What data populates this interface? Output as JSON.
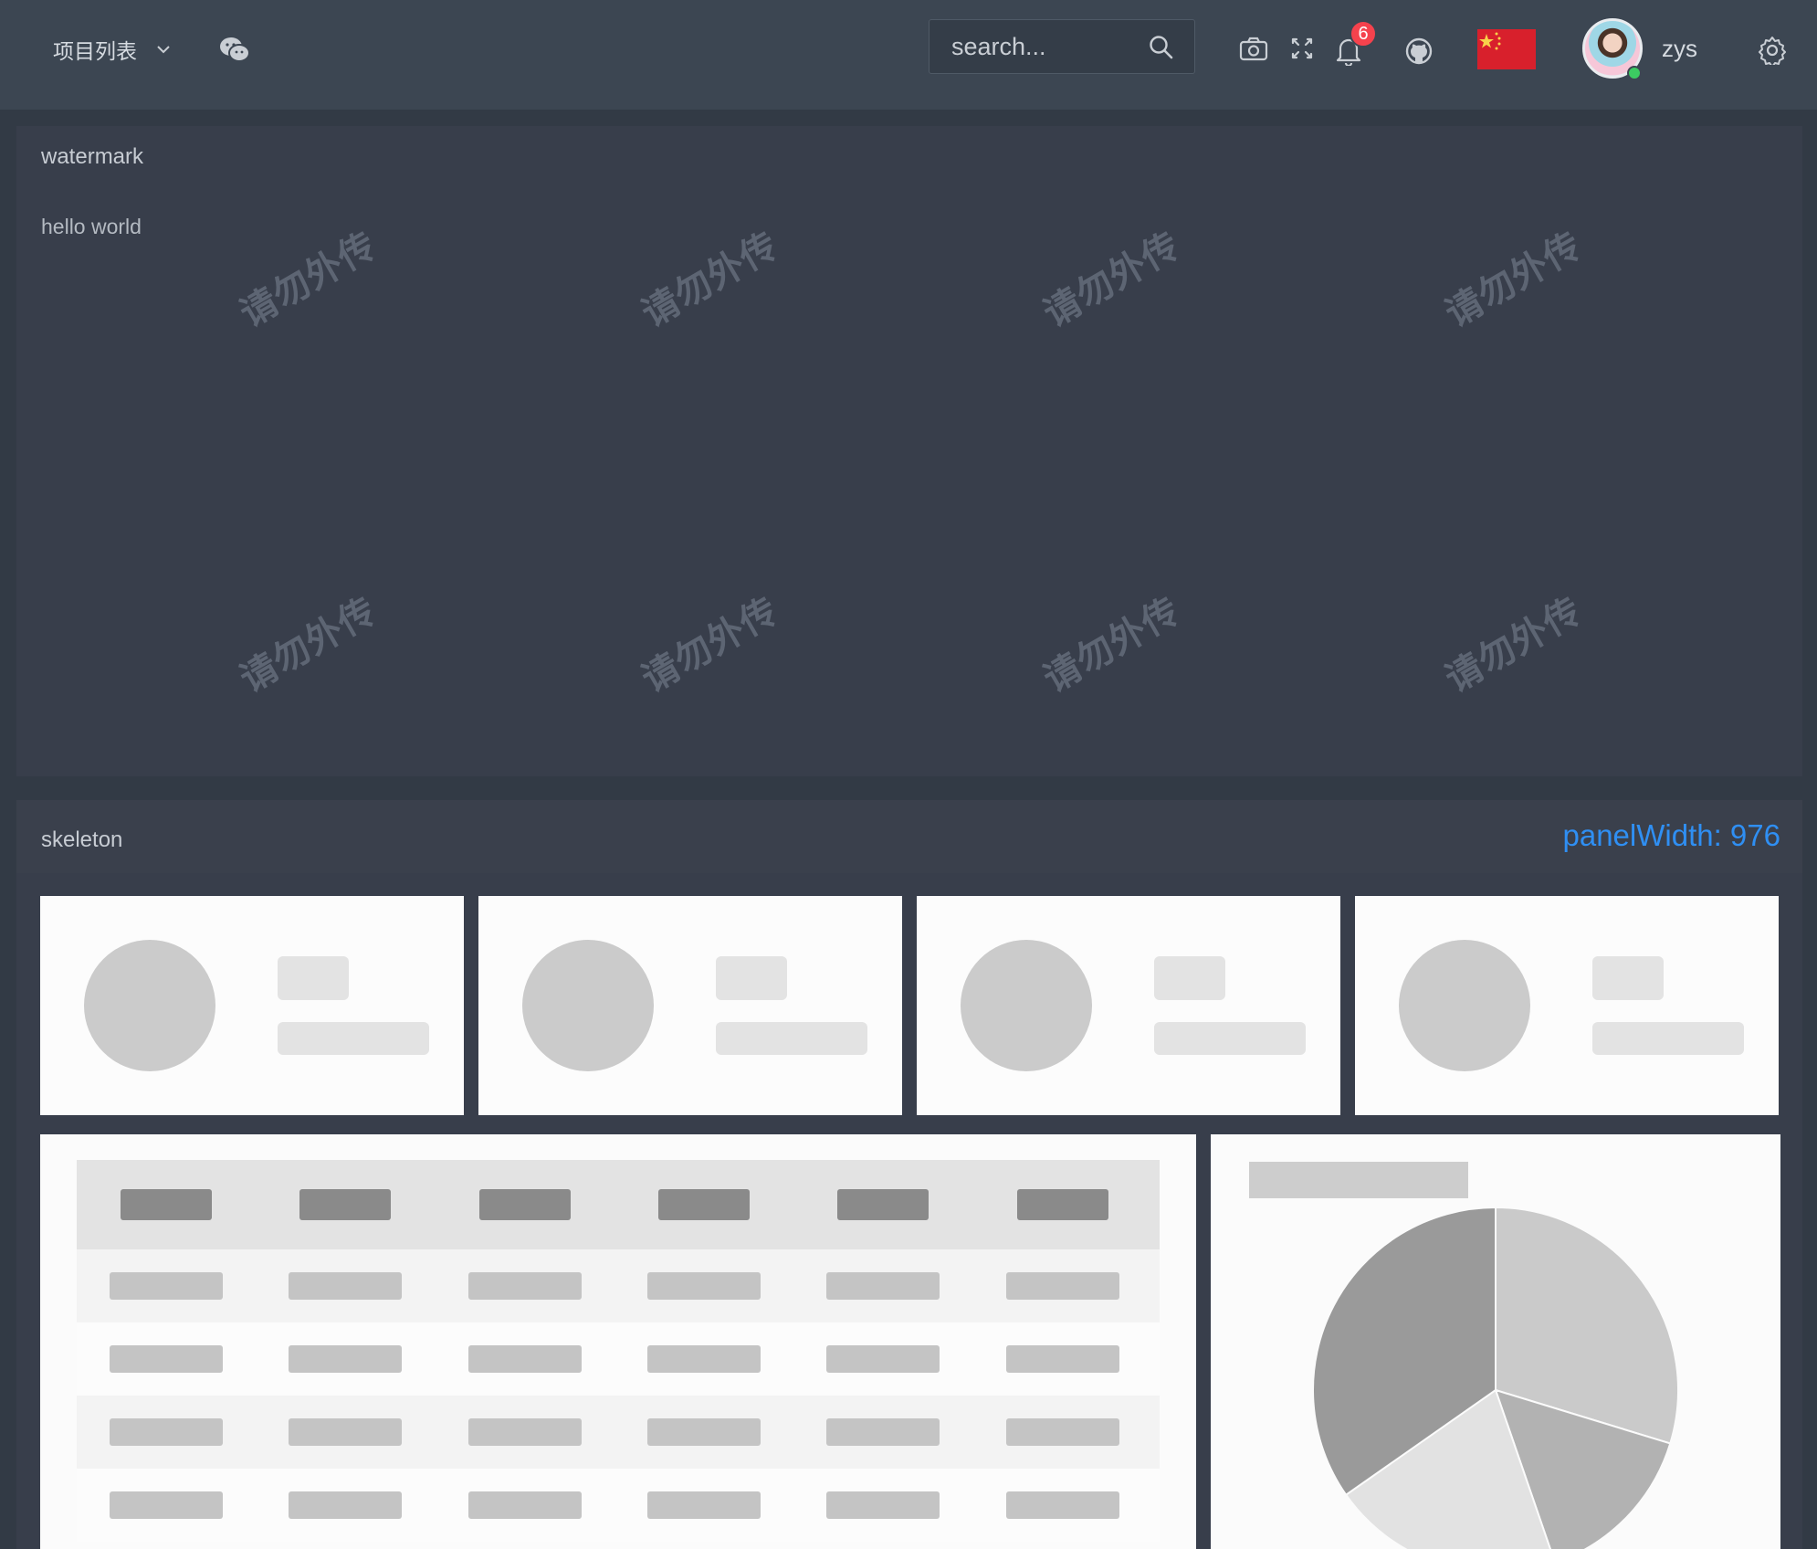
{
  "header": {
    "project_menu_label": "项目列表",
    "search_placeholder": "search...",
    "notification_count": "6",
    "username": "zys",
    "icons": [
      "chevron-down-icon",
      "wechat-icon",
      "search-icon",
      "camera-icon",
      "fullscreen-icon",
      "bell-icon",
      "github-icon",
      "china-flag-icon",
      "avatar",
      "gear-icon"
    ]
  },
  "watermark_panel": {
    "title": "watermark",
    "content": "hello world",
    "watermark_text": "请勿外传"
  },
  "skeleton_panel": {
    "title": "skeleton",
    "panel_width_label": "panelWidth: 976",
    "colors": {
      "card_bg": "#fcfcfc",
      "circle": "#cbcbcb",
      "bar": "#e3e3e3",
      "table_header_bg": "#e3e3e3",
      "table_header_cell": "#8a8a8a",
      "table_cell": "#c4c4c4",
      "pie_slices": [
        "#cacaca",
        "#b2b2b2",
        "#e2e2e2",
        "#9a9a9a"
      ]
    }
  }
}
